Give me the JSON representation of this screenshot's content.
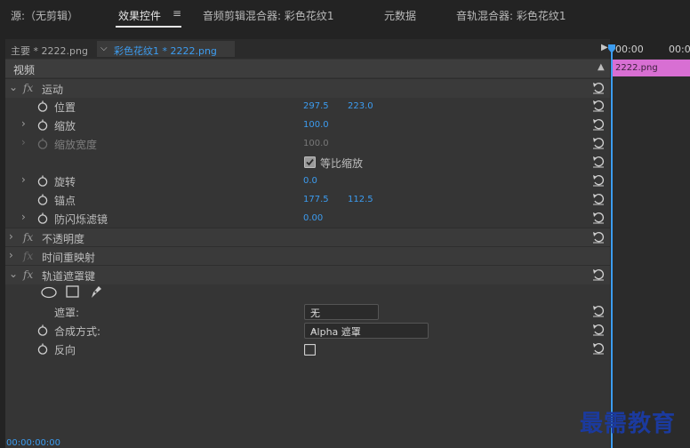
{
  "tabs": [
    {
      "label": "源:（无剪辑）"
    },
    {
      "label": "效果控件"
    },
    {
      "label": "音频剪辑混合器: 彩色花纹1"
    },
    {
      "label": "元数据"
    },
    {
      "label": "音轨混合器: 彩色花纹1"
    }
  ],
  "menu_icon": "≡",
  "breadcrumb": {
    "main": "主要 * 2222.png",
    "clip": "彩色花纹1 * 2222.png"
  },
  "section_title": "视频",
  "timeline": {
    "timecode_start": "00:00",
    "timecode_next": "00:00",
    "clip_label": "2222.png"
  },
  "effects": {
    "motion": {
      "name": "运动",
      "position": {
        "label": "位置",
        "x": "297.5",
        "y": "223.0"
      },
      "scale": {
        "label": "缩放",
        "value": "100.0"
      },
      "scale_width": {
        "label": "缩放宽度",
        "value": "100.0"
      },
      "uniform_scale": {
        "label": "等比缩放",
        "checked": true
      },
      "rotation": {
        "label": "旋转",
        "value": "0.0"
      },
      "anchor": {
        "label": "锚点",
        "x": "177.5",
        "y": "112.5"
      },
      "antiflicker": {
        "label": "防闪烁滤镜",
        "value": "0.00"
      }
    },
    "opacity": {
      "name": "不透明度"
    },
    "time_remap": {
      "name": "时间重映射"
    },
    "track_matte": {
      "name": "轨道遮罩键",
      "matte": {
        "label": "遮罩:",
        "value": "无"
      },
      "composite": {
        "label": "合成方式:",
        "value": "Alpha 遮罩"
      },
      "reverse": {
        "label": "反向",
        "checked": false
      }
    }
  },
  "footer_timecode": "00:00:00:00",
  "watermark": "最需教育",
  "colors": {
    "accent": "#3c9cf0",
    "clip": "#d86fd3"
  }
}
